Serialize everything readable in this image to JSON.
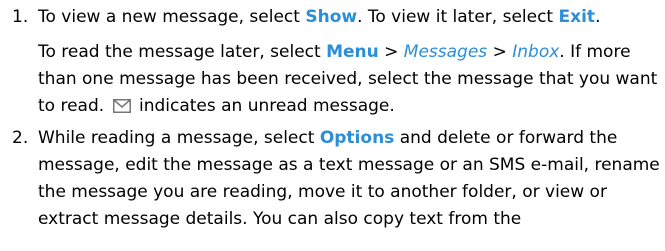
{
  "steps": [
    {
      "number": "1.",
      "line1": {
        "t1": "To view a new message, select ",
        "k1": "Show",
        "t2": ". To view it later, select ",
        "k2": "Exit",
        "t3": "."
      },
      "para2": {
        "t1": "To read the message later, select ",
        "k1": "Menu",
        "sep1": " > ",
        "p1": "Messages",
        "sep2": " > ",
        "p2": "Inbox",
        "t2": ". If more than one message has been received, select the message that you want to read.",
        "icon": "envelope-icon",
        "t3": " indicates an unread message."
      }
    },
    {
      "number": "2.",
      "t1": "While reading a message, select ",
      "k1": "Options",
      "t2": " and delete or forward the message, edit the message as a text message or an SMS e-mail, rename the message you are reading, move it to another folder, or view or extract message details. You can also copy text from the"
    }
  ],
  "colors": {
    "keyword": "#2a8fd8",
    "text": "#000000"
  }
}
